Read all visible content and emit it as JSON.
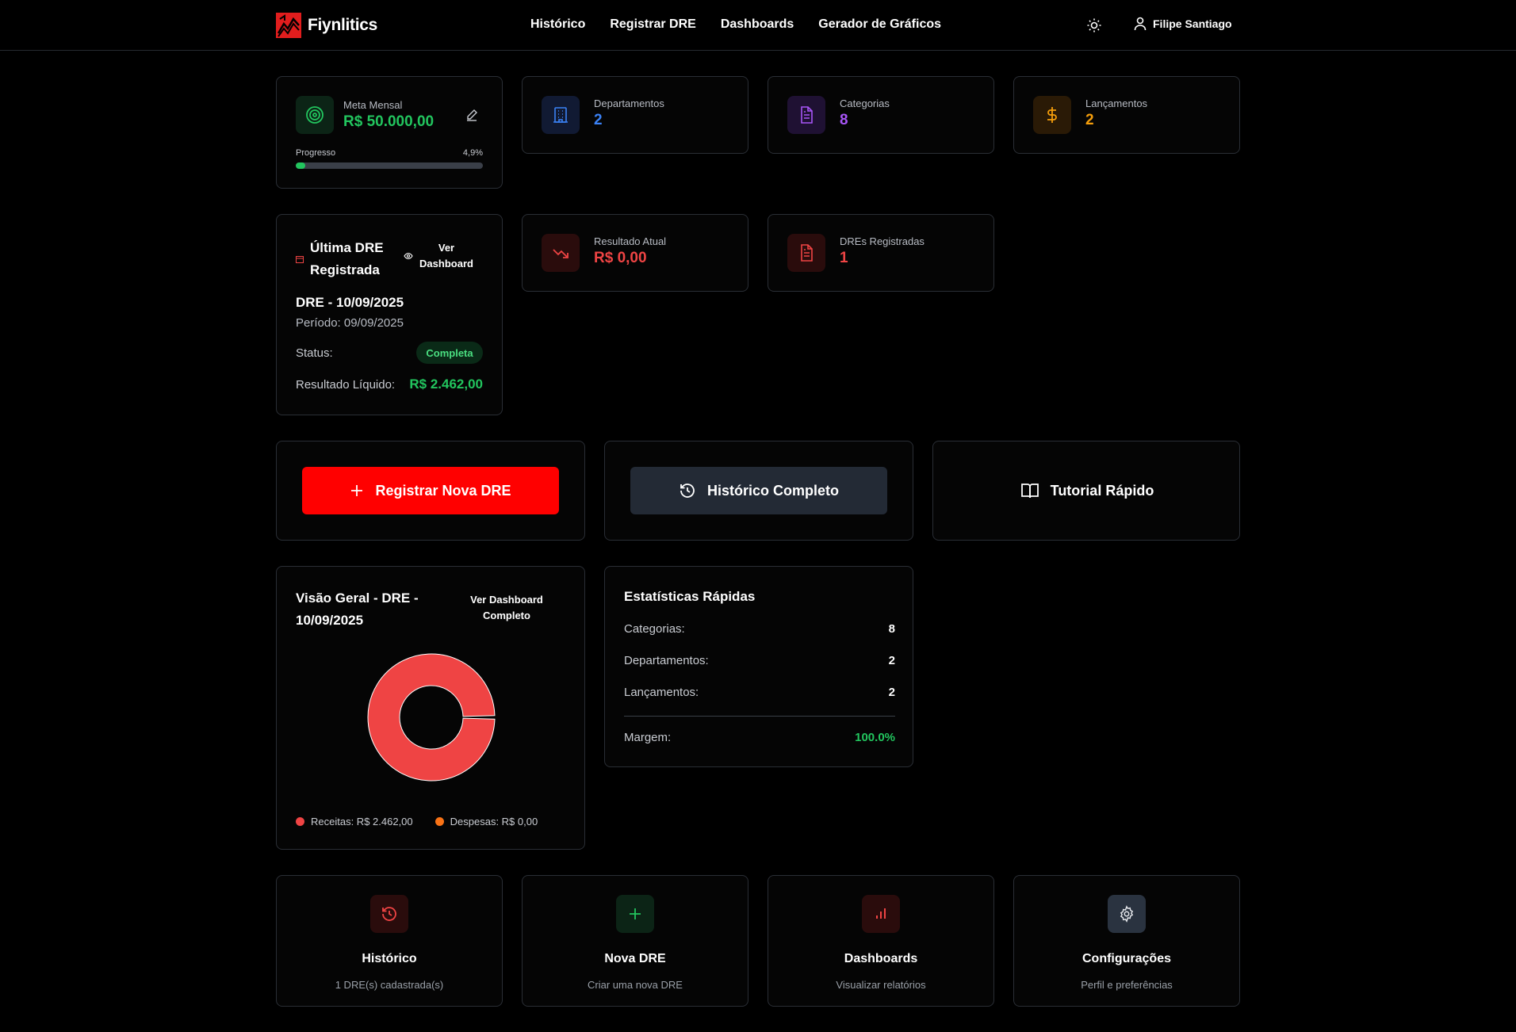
{
  "brand": {
    "name": "Fiynlitics"
  },
  "nav": {
    "links": [
      "Histórico",
      "Registrar DRE",
      "Dashboards",
      "Gerador de Gráficos"
    ],
    "user": "Filipe Santiago"
  },
  "meta": {
    "label": "Meta Mensal",
    "value": "R$ 50.000,00",
    "progress_label": "Progresso",
    "progress_text": "4,9%",
    "progress_value": 0.049
  },
  "stats": [
    {
      "label": "Departamentos",
      "value": "2",
      "color": "#3b82f6"
    },
    {
      "label": "Categorias",
      "value": "8",
      "color": "#a855f7"
    },
    {
      "label": "Lançamentos",
      "value": "2",
      "color": "#f59e0b"
    }
  ],
  "last_dre": {
    "title": "Última DRE Registrada",
    "view_label": "Ver Dashboard",
    "name": "DRE - 10/09/2025",
    "period": "Período: 09/09/2025",
    "status_label": "Status:",
    "status": "Completa",
    "result_label": "Resultado Líquido:",
    "result": "R$ 2.462,00"
  },
  "result_card": {
    "label": "Resultado Atual",
    "value": "R$ 0,00"
  },
  "dres_card": {
    "label": "DREs Registradas",
    "value": "1"
  },
  "actions": {
    "new_dre": "Registrar Nova DRE",
    "history": "Histórico Completo",
    "tutorial": "Tutorial Rápido"
  },
  "overview": {
    "title": "Visão Geral - DRE - 10/09/2025",
    "link": "Ver Dashboard Completo",
    "legend": [
      "Receitas: R$ 2.462,00",
      "Despesas: R$ 0,00"
    ]
  },
  "chart_data": {
    "type": "pie",
    "categories": [
      "Receitas",
      "Despesas"
    ],
    "values": [
      2462,
      0
    ],
    "colors": [
      "#ef4444",
      "#f97316"
    ]
  },
  "quick_stats": {
    "title": "Estatísticas Rápidas",
    "rows": [
      {
        "label": "Categorias:",
        "value": "8"
      },
      {
        "label": "Departamentos:",
        "value": "2"
      },
      {
        "label": "Lançamentos:",
        "value": "2"
      }
    ],
    "margin_label": "Margem:",
    "margin_value": "100.0%"
  },
  "quick_links": [
    {
      "title": "Histórico",
      "sub": "1 DRE(s) cadastrada(s)"
    },
    {
      "title": "Nova DRE",
      "sub": "Criar uma nova DRE"
    },
    {
      "title": "Dashboards",
      "sub": "Visualizar relatórios"
    },
    {
      "title": "Configurações",
      "sub": "Perfil e preferências"
    }
  ]
}
